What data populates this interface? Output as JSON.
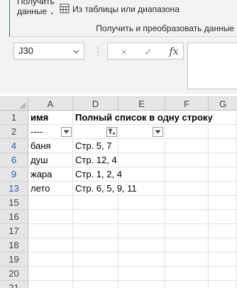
{
  "ribbon": {
    "get_data_label": "Получить данные",
    "get_data_chevron": "⌄",
    "from_table_label": "Из таблицы или диапазона",
    "group_label": "Получить и преобразовать данные"
  },
  "formula_bar": {
    "name_box": "J30",
    "cancel_icon": "×",
    "confirm_icon": "✓",
    "fx_label": "fx",
    "formula_value": ""
  },
  "columns": [
    "A",
    "D",
    "E",
    "F",
    "G"
  ],
  "rows": [
    {
      "num": "1",
      "filtered": false,
      "A": "имя",
      "D": "Полный список в одну строку",
      "bold": true
    },
    {
      "num": "2",
      "filtered": false,
      "A": "----",
      "D": "",
      "bold": false
    },
    {
      "num": "4",
      "filtered": true,
      "A": "баня",
      "D": "Стр. 5, 7",
      "bold": false
    },
    {
      "num": "6",
      "filtered": true,
      "A": "душ",
      "D": "Стр. 12, 4",
      "bold": false
    },
    {
      "num": "9",
      "filtered": true,
      "A": "жара",
      "D": "Стр. 1, 2, 4",
      "bold": false
    },
    {
      "num": "13",
      "filtered": true,
      "A": "лето",
      "D": "Стр. 6, 5, 9, 11",
      "bold": false
    },
    {
      "num": "15",
      "filtered": false,
      "A": "",
      "D": "",
      "bold": false
    },
    {
      "num": "16",
      "filtered": false,
      "A": "",
      "D": "",
      "bold": false
    },
    {
      "num": "17",
      "filtered": false,
      "A": "",
      "D": "",
      "bold": false
    },
    {
      "num": "18",
      "filtered": false,
      "A": "",
      "D": "",
      "bold": false
    },
    {
      "num": "19",
      "filtered": false,
      "A": "",
      "D": "",
      "bold": false
    },
    {
      "num": "20",
      "filtered": false,
      "A": "",
      "D": "",
      "bold": false
    },
    {
      "num": "21",
      "filtered": false,
      "A": "",
      "D": "",
      "bold": false
    }
  ],
  "filter_buttons": [
    {
      "column": "A",
      "state": "dropdown"
    },
    {
      "column": "D",
      "state": "filter-active"
    },
    {
      "column": "E",
      "state": "dropdown"
    }
  ],
  "colors": {
    "filtered_row_number": "#1f5fbf",
    "header_bg": "#e6e6e6",
    "ribbon_bg": "#f3f3f3"
  }
}
